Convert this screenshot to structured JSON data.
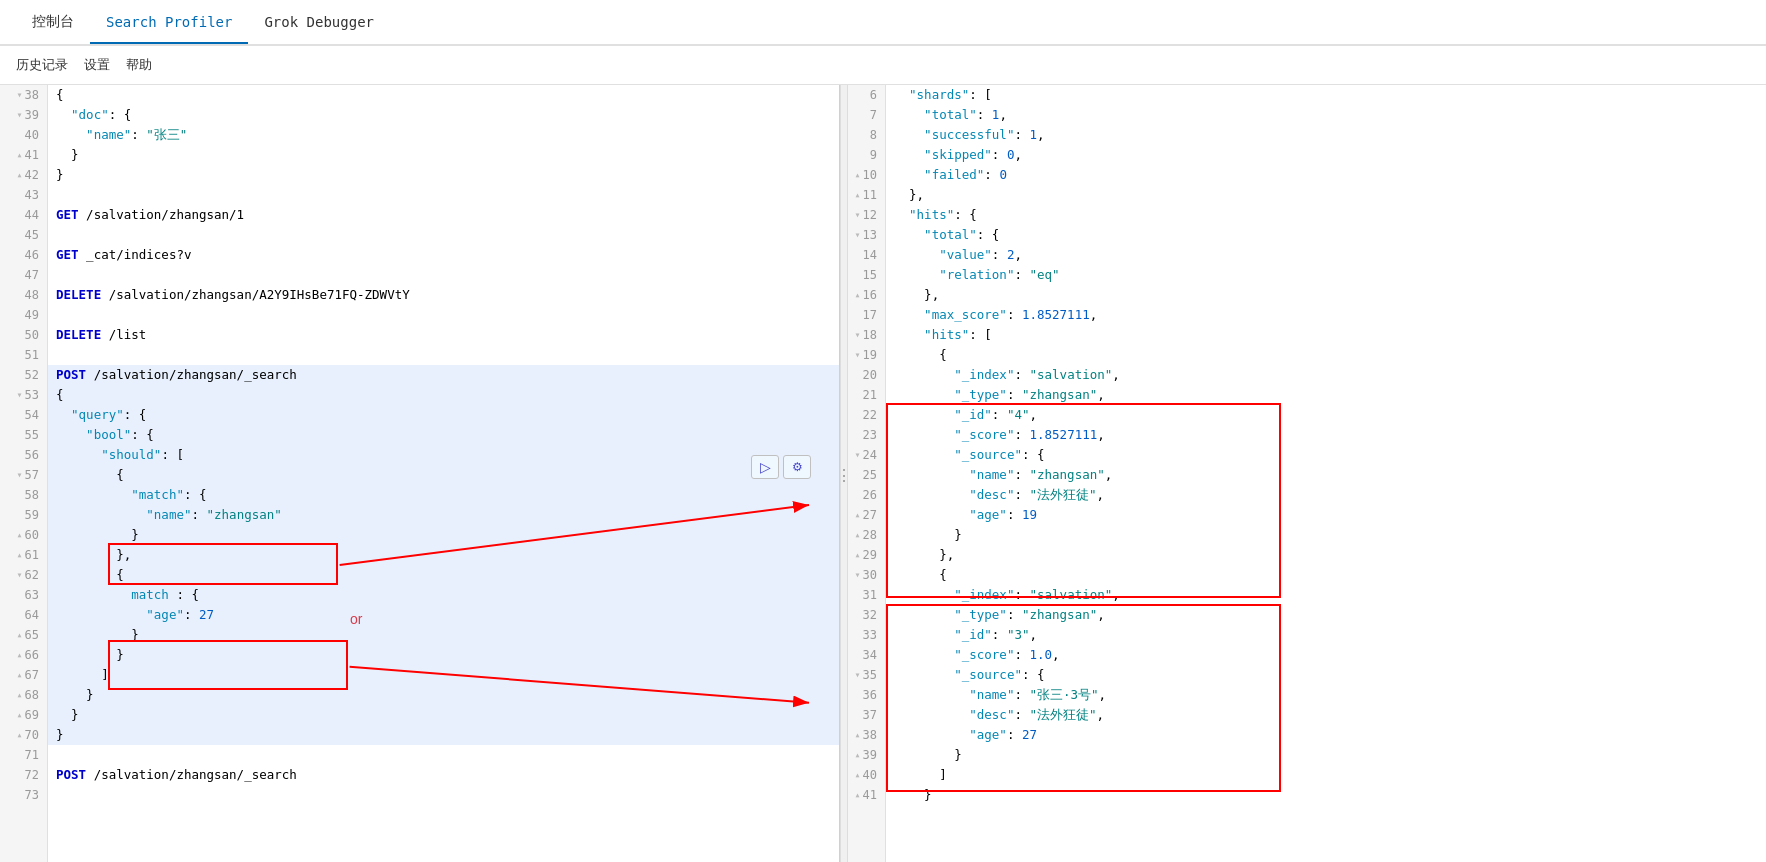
{
  "topNav": {
    "tabs": [
      {
        "id": "console",
        "label": "控制台",
        "active": false
      },
      {
        "id": "search-profiler",
        "label": "Search Profiler",
        "active": true
      },
      {
        "id": "grok-debugger",
        "label": "Grok Debugger",
        "active": false
      }
    ]
  },
  "secondNav": {
    "items": [
      {
        "id": "history",
        "label": "历史记录"
      },
      {
        "id": "settings",
        "label": "设置"
      },
      {
        "id": "help",
        "label": "帮助"
      }
    ]
  },
  "editor": {
    "toolbar": {
      "run_label": "▷",
      "wrench_label": "🔧"
    }
  },
  "orLabel": "or",
  "leftLines": [
    {
      "num": 38,
      "fold": "▾",
      "text": "{",
      "highlight": false
    },
    {
      "num": 39,
      "fold": "▾",
      "text": "  \"doc\": {",
      "highlight": false
    },
    {
      "num": 40,
      "fold": "",
      "text": "    \"name\": \"张三\"",
      "highlight": false
    },
    {
      "num": 41,
      "fold": "▴",
      "text": "  }",
      "highlight": false
    },
    {
      "num": 42,
      "fold": "▴",
      "text": "}",
      "highlight": false
    },
    {
      "num": 43,
      "fold": "",
      "text": "",
      "highlight": false
    },
    {
      "num": 44,
      "fold": "",
      "text": "GET /salvation/zhangsan/1",
      "highlight": false
    },
    {
      "num": 45,
      "fold": "",
      "text": "",
      "highlight": false
    },
    {
      "num": 46,
      "fold": "",
      "text": "GET _cat/indices?v",
      "highlight": false
    },
    {
      "num": 47,
      "fold": "",
      "text": "",
      "highlight": false
    },
    {
      "num": 48,
      "fold": "",
      "text": "DELETE /salvation/zhangsan/A2Y9IHsBe71FQ-ZDWVtY",
      "highlight": false
    },
    {
      "num": 49,
      "fold": "",
      "text": "",
      "highlight": false
    },
    {
      "num": 50,
      "fold": "",
      "text": "DELETE /list",
      "highlight": false
    },
    {
      "num": 51,
      "fold": "",
      "text": "",
      "highlight": false
    },
    {
      "num": 52,
      "fold": "",
      "text": "POST /salvation/zhangsan/_search",
      "highlight": true
    },
    {
      "num": 53,
      "fold": "▾",
      "text": "{",
      "highlight": true
    },
    {
      "num": 54,
      "fold": "",
      "text": "  \"query\": {",
      "highlight": true
    },
    {
      "num": 55,
      "fold": "",
      "text": "    \"bool\": {",
      "highlight": true
    },
    {
      "num": 56,
      "fold": "",
      "text": "      \"should\": [",
      "highlight": true
    },
    {
      "num": 57,
      "fold": "▾",
      "text": "        {",
      "highlight": true
    },
    {
      "num": 58,
      "fold": "",
      "text": "          \"match\": {",
      "highlight": true
    },
    {
      "num": 59,
      "fold": "",
      "text": "            \"name\": \"zhangsan\"",
      "highlight": true
    },
    {
      "num": 60,
      "fold": "▴",
      "text": "          }",
      "highlight": true
    },
    {
      "num": 61,
      "fold": "▴",
      "text": "        },",
      "highlight": true
    },
    {
      "num": 62,
      "fold": "▾",
      "text": "        {",
      "highlight": true
    },
    {
      "num": 63,
      "fold": "",
      "text": "          match : {",
      "highlight": true
    },
    {
      "num": 64,
      "fold": "",
      "text": "            \"age\": 27",
      "highlight": true
    },
    {
      "num": 65,
      "fold": "▴",
      "text": "          }",
      "highlight": true
    },
    {
      "num": 66,
      "fold": "▴",
      "text": "        }",
      "highlight": true
    },
    {
      "num": 67,
      "fold": "▴",
      "text": "      ]",
      "highlight": true
    },
    {
      "num": 68,
      "fold": "▴",
      "text": "    }",
      "highlight": true
    },
    {
      "num": 69,
      "fold": "▴",
      "text": "  }",
      "highlight": true
    },
    {
      "num": 70,
      "fold": "▴",
      "text": "}",
      "highlight": true
    },
    {
      "num": 71,
      "fold": "",
      "text": "",
      "highlight": false
    },
    {
      "num": 72,
      "fold": "",
      "text": "POST /salvation/zhangsan/_search",
      "highlight": false
    },
    {
      "num": 73,
      "fold": "",
      "text": "",
      "highlight": false
    }
  ],
  "rightLines": [
    {
      "num": 6,
      "fold": "",
      "text": "  \"shards\" : ["
    },
    {
      "num": 7,
      "fold": "",
      "text": "    \"total\" : 1,"
    },
    {
      "num": 8,
      "fold": "",
      "text": "    \"successful\" : 1,"
    },
    {
      "num": 9,
      "fold": "",
      "text": "    \"skipped\" : 0,"
    },
    {
      "num": 10,
      "fold": "▴",
      "text": "    \"failed\" : 0"
    },
    {
      "num": 11,
      "fold": "▴",
      "text": "  },"
    },
    {
      "num": 12,
      "fold": "▾",
      "text": "  \"hits\" : {"
    },
    {
      "num": 13,
      "fold": "▾",
      "text": "    \"total\" : {"
    },
    {
      "num": 14,
      "fold": "",
      "text": "      \"value\" : 2,"
    },
    {
      "num": 15,
      "fold": "",
      "text": "      \"relation\" : \"eq\""
    },
    {
      "num": 16,
      "fold": "▴",
      "text": "    },"
    },
    {
      "num": 17,
      "fold": "",
      "text": "    \"max_score\" : 1.8527111,"
    },
    {
      "num": 18,
      "fold": "▾",
      "text": "    \"hits\" : ["
    },
    {
      "num": 19,
      "fold": "▾",
      "text": "      {"
    },
    {
      "num": 20,
      "fold": "",
      "text": "        \"_index\" : \"salvation\","
    },
    {
      "num": 21,
      "fold": "",
      "text": "        \"_type\" : \"zhangsan\","
    },
    {
      "num": 22,
      "fold": "",
      "text": "        \"_id\" : \"4\","
    },
    {
      "num": 23,
      "fold": "",
      "text": "        \"_score\" : 1.8527111,"
    },
    {
      "num": 24,
      "fold": "▾",
      "text": "        \"_source\" : {"
    },
    {
      "num": 25,
      "fold": "",
      "text": "          \"name\" : \"zhangsan\","
    },
    {
      "num": 26,
      "fold": "",
      "text": "          \"desc\" : \"法外狂徒\","
    },
    {
      "num": 27,
      "fold": "▴",
      "text": "          \"age\" : 19"
    },
    {
      "num": 28,
      "fold": "▴",
      "text": "        }"
    },
    {
      "num": 29,
      "fold": "▴",
      "text": "      },"
    },
    {
      "num": 30,
      "fold": "▾",
      "text": "      {"
    },
    {
      "num": 31,
      "fold": "",
      "text": "        \"_index\" : \"salvation\","
    },
    {
      "num": 32,
      "fold": "",
      "text": "        \"_type\" : \"zhangsan\","
    },
    {
      "num": 33,
      "fold": "",
      "text": "        \"_id\" : \"3\","
    },
    {
      "num": 34,
      "fold": "",
      "text": "        \"_score\" : 1.0,"
    },
    {
      "num": 35,
      "fold": "▾",
      "text": "        \"_source\" : {"
    },
    {
      "num": 36,
      "fold": "",
      "text": "          \"name\" : \"张三·3号\","
    },
    {
      "num": 37,
      "fold": "",
      "text": "          \"desc\" : \"法外狂徒\","
    },
    {
      "num": 38,
      "fold": "▴",
      "text": "          \"age\" : 27"
    },
    {
      "num": 39,
      "fold": "▴",
      "text": "        }"
    },
    {
      "num": 40,
      "fold": "▴",
      "text": "      ]"
    },
    {
      "num": 41,
      "fold": "▴",
      "text": "    }"
    }
  ]
}
